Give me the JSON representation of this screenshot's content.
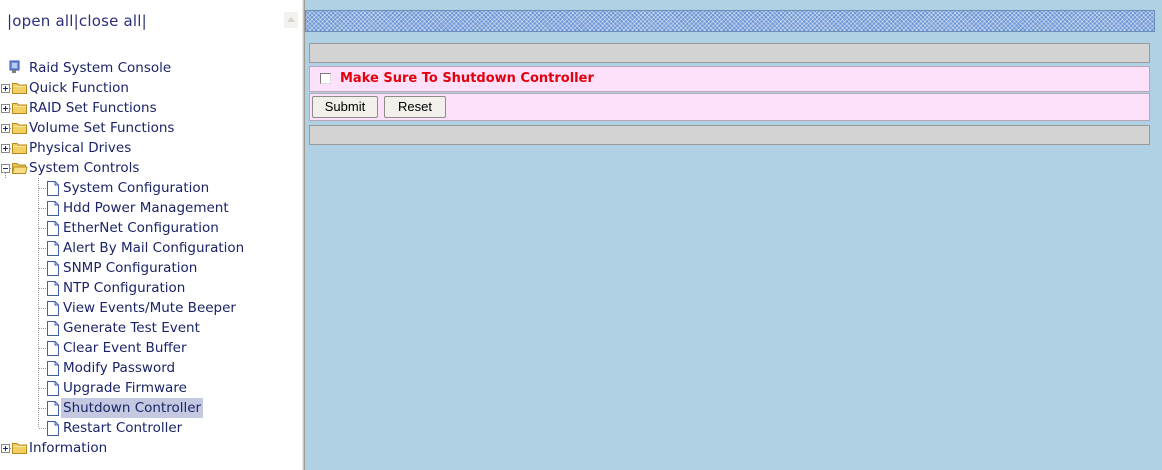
{
  "left_frame": {
    "open_all": "open all",
    "close_all": "close all",
    "tree": {
      "root": "Raid System Console",
      "folders": [
        {
          "label": "Quick Function",
          "expanded": false
        },
        {
          "label": "RAID Set Functions",
          "expanded": false
        },
        {
          "label": "Volume Set Functions",
          "expanded": false
        },
        {
          "label": "Physical Drives",
          "expanded": false
        },
        {
          "label": "System Controls",
          "expanded": true
        },
        {
          "label": "Information",
          "expanded": false
        }
      ],
      "system_controls_items": [
        "System Configuration",
        "Hdd Power Management",
        "EtherNet Configuration",
        "Alert By Mail Configuration",
        "SNMP Configuration",
        "NTP Configuration",
        "View Events/Mute Beeper",
        "Generate Test Event",
        "Clear Event Buffer",
        "Modify Password",
        "Upgrade Firmware",
        "Shutdown Controller",
        "Restart Controller"
      ],
      "selected_item": "Shutdown Controller"
    }
  },
  "main": {
    "checkbox_label": "Make Sure To Shutdown Controller",
    "checkbox_checked": false,
    "submit_label": "Submit",
    "reset_label": "Reset"
  },
  "colors": {
    "main_background": "#b0d0e3",
    "form_row_background": "#fde0fa",
    "warning_text": "#e4000c",
    "tree_text": "#1b2466",
    "selection_highlight": "#c4c9e1"
  }
}
